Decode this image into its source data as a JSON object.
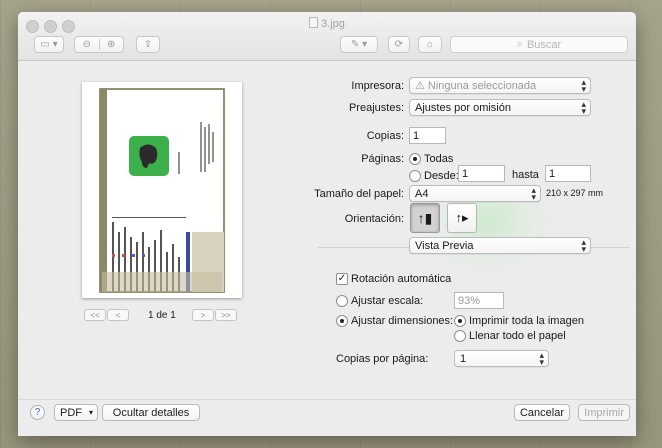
{
  "window": {
    "title": "3.jpg"
  },
  "toolbar": {
    "search_placeholder": "Buscar",
    "sidebar_icon": "sidebar-icon",
    "zoom_out_icon": "zoom-out-icon",
    "zoom_in_icon": "zoom-in-icon",
    "share_icon": "share-icon",
    "markup_icon": "pen-icon",
    "rotate_icon": "rotate-icon",
    "toolbox_icon": "toolbox-icon"
  },
  "print": {
    "printer_label": "Impresora:",
    "printer_value": "⚠ Ninguna seleccionada",
    "presets_label": "Preajustes:",
    "presets_value": "Ajustes por omisión",
    "copies_label": "Copias:",
    "copies_value": "1",
    "pages_label": "Páginas:",
    "pages_all": "Todas",
    "pages_from": "Desde:",
    "pages_from_value": "1",
    "pages_to": "hasta",
    "pages_to_value": "1",
    "paper_label": "Tamaño del papel:",
    "paper_value": "A4",
    "paper_dims": "210 x 297 mm",
    "orientation_label": "Orientación:",
    "section_value": "Vista Previa",
    "auto_rotate": "Rotación automática",
    "scale_label": "Ajustar escala:",
    "scale_value": "93%",
    "fit_label": "Ajustar dimensiones:",
    "fit_print_all": "Imprimir toda la imagen",
    "fit_fill": "Llenar todo el papel",
    "copies_per_page_label": "Copias por página:",
    "copies_per_page_value": "1"
  },
  "preview_nav": {
    "first": "<<",
    "prev": "<",
    "page": "1 de 1",
    "next": ">",
    "last": ">>"
  },
  "footer": {
    "help": "?",
    "pdf": "PDF",
    "hide_details": "Ocultar detalles",
    "cancel": "Cancelar",
    "print": "Imprimir"
  }
}
